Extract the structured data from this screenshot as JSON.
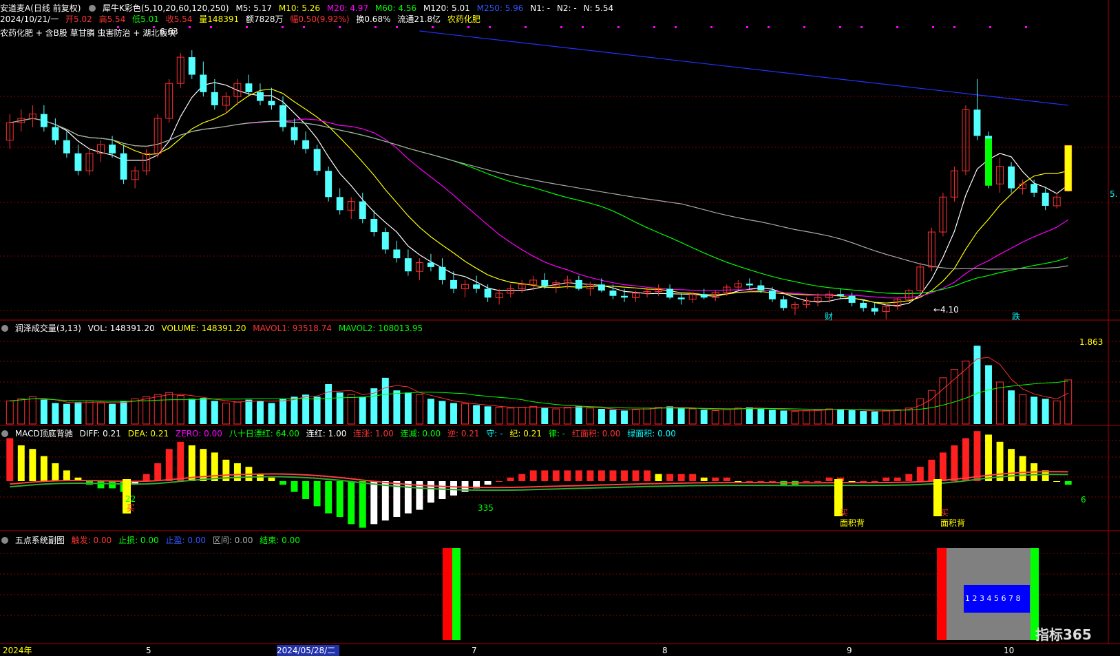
{
  "header": {
    "stock_title": "安道麦A(日线 前复权)",
    "indicator_name": "犀牛K彩色(5,10,20,60,120,250)",
    "ma5": "M5: 5.17",
    "ma10": "M10: 5.26",
    "ma20": "M20: 4.97",
    "ma60": "M60: 4.56",
    "ma120": "M120: 5.01",
    "ma250": "M250: 5.96",
    "n1": "N1: -",
    "n2": "N2: -",
    "n": "N: 5.54",
    "date_line": "2024/10/21/一",
    "open": "开5.02",
    "high": "高5.54",
    "low": "低5.01",
    "close": "收5.54",
    "volume": "量148391",
    "amount": "额7828万",
    "change": "幅0.50(9.92%)",
    "turnover": "换0.68%",
    "float_cap": "流通21.8亿",
    "sector": "农药化肥",
    "concepts": "农药化肥 + 含B股 草甘膦 虫害防治 + 湖北板块",
    "peak_label": "6.63",
    "low_label": "←4.10",
    "mark_cai": "财",
    "mark_die": "跌"
  },
  "volume_panel": {
    "title": "润泽成交量(3,13)",
    "vol": "VOL: 148391.20",
    "volume": "VOLUME: 148391.20",
    "mavol1": "MAVOL1: 93518.74",
    "mavol2": "MAVOL2: 108013.95",
    "max_label": "1.863"
  },
  "macd_panel": {
    "title": "MACD顶底背驰",
    "diff": "DIFF: 0.21",
    "dea": "DEA: 0.21",
    "zero": "ZERO: 0.00",
    "eighty": "八十日漂红: 64.00",
    "lianhong": "连红: 1.00",
    "lianzhang": "连涨: 1.00",
    "lianjian": "连减: 0.00",
    "ni": "逆: 0.21",
    "shou": "守: -",
    "ji": "纪: 0.21",
    "lv": "律: -",
    "red_area": "红面积: 0.00",
    "green_area": "绿面积: 0.00",
    "label_22": "22",
    "label_335": "335",
    "label_6": "6",
    "buy": "买",
    "area_div": "面积背"
  },
  "five_panel": {
    "title": "五点系统副图",
    "chufa": "触发: 0.00",
    "zhisun": "止损: 0.00",
    "zhiying": "止盈: 0.00",
    "qujian": "区间: 0.00",
    "jieshu": "结束: 0.00",
    "box_label": "1 2 3 4 5 6 7 8"
  },
  "time_axis": {
    "labels": [
      "2024年",
      "5",
      "2024/05/28/二",
      "7",
      "8",
      "9",
      "10"
    ]
  },
  "watermark": "指标365",
  "price_axis_label": "5.",
  "colors": {
    "up": "#ff3030",
    "down": "#54ffff",
    "ma5": "#ffffff",
    "ma10": "#ffff00",
    "ma20": "#ff00ff",
    "ma60": "#00ff00",
    "ma120": "#aaaaaa",
    "ma250": "#2233ff",
    "grid": "#8b0000"
  },
  "chart_data": {
    "type": "candlestick",
    "price_range": [
      3.7,
      6.85
    ],
    "candles": [
      [
        5.6,
        5.9,
        5.5,
        5.8
      ],
      [
        5.8,
        5.95,
        5.7,
        5.85
      ],
      [
        5.85,
        6.0,
        5.75,
        5.9
      ],
      [
        5.9,
        6.0,
        5.7,
        5.75
      ],
      [
        5.75,
        5.85,
        5.55,
        5.6
      ],
      [
        5.6,
        5.7,
        5.4,
        5.45
      ],
      [
        5.45,
        5.55,
        5.2,
        5.25
      ],
      [
        5.25,
        5.5,
        5.2,
        5.45
      ],
      [
        5.45,
        5.6,
        5.35,
        5.55
      ],
      [
        5.55,
        5.65,
        5.4,
        5.45
      ],
      [
        5.45,
        5.55,
        5.1,
        5.15
      ],
      [
        5.15,
        5.3,
        5.05,
        5.25
      ],
      [
        5.25,
        5.5,
        5.2,
        5.45
      ],
      [
        5.45,
        5.9,
        5.4,
        5.85
      ],
      [
        5.85,
        6.3,
        5.8,
        6.25
      ],
      [
        6.25,
        6.6,
        6.2,
        6.55
      ],
      [
        6.55,
        6.63,
        6.3,
        6.35
      ],
      [
        6.35,
        6.5,
        6.1,
        6.15
      ],
      [
        6.15,
        6.3,
        5.95,
        6.0
      ],
      [
        6.0,
        6.15,
        5.9,
        6.1
      ],
      [
        6.1,
        6.3,
        6.0,
        6.25
      ],
      [
        6.25,
        6.35,
        6.1,
        6.15
      ],
      [
        6.15,
        6.25,
        6.0,
        6.05
      ],
      [
        6.05,
        6.2,
        5.95,
        6.0
      ],
      [
        6.0,
        6.1,
        5.7,
        5.75
      ],
      [
        5.75,
        5.85,
        5.55,
        5.6
      ],
      [
        5.6,
        5.7,
        5.45,
        5.5
      ],
      [
        5.5,
        5.55,
        5.2,
        5.25
      ],
      [
        5.25,
        5.3,
        4.9,
        4.95
      ],
      [
        4.95,
        5.05,
        4.75,
        4.8
      ],
      [
        4.8,
        4.95,
        4.7,
        4.9
      ],
      [
        4.9,
        5.0,
        4.65,
        4.7
      ],
      [
        4.7,
        4.8,
        4.5,
        4.55
      ],
      [
        4.55,
        4.6,
        4.3,
        4.35
      ],
      [
        4.35,
        4.45,
        4.2,
        4.25
      ],
      [
        4.25,
        4.35,
        4.05,
        4.1
      ],
      [
        4.1,
        4.25,
        4.0,
        4.2
      ],
      [
        4.2,
        4.3,
        4.1,
        4.15
      ],
      [
        4.15,
        4.25,
        3.95,
        4.0
      ],
      [
        4.0,
        4.1,
        3.85,
        3.9
      ],
      [
        3.9,
        4.0,
        3.8,
        3.95
      ],
      [
        3.95,
        4.05,
        3.85,
        3.9
      ],
      [
        3.9,
        3.95,
        3.75,
        3.8
      ],
      [
        3.8,
        3.9,
        3.72,
        3.85
      ],
      [
        3.85,
        3.95,
        3.8,
        3.9
      ],
      [
        3.9,
        4.0,
        3.85,
        3.95
      ],
      [
        3.95,
        4.05,
        3.88,
        4.0
      ],
      [
        4.0,
        4.08,
        3.9,
        3.93
      ],
      [
        3.93,
        4.0,
        3.85,
        3.97
      ],
      [
        3.97,
        4.05,
        3.9,
        4.0
      ],
      [
        4.0,
        4.05,
        3.88,
        3.9
      ],
      [
        3.9,
        3.98,
        3.82,
        3.95
      ],
      [
        3.95,
        4.02,
        3.86,
        3.88
      ],
      [
        3.88,
        3.95,
        3.78,
        3.82
      ],
      [
        3.82,
        3.9,
        3.75,
        3.8
      ],
      [
        3.8,
        3.88,
        3.75,
        3.85
      ],
      [
        3.85,
        3.92,
        3.8,
        3.87
      ],
      [
        3.87,
        3.95,
        3.82,
        3.9
      ],
      [
        3.9,
        3.95,
        3.78,
        3.8
      ],
      [
        3.8,
        3.85,
        3.72,
        3.78
      ],
      [
        3.78,
        3.86,
        3.74,
        3.84
      ],
      [
        3.84,
        3.9,
        3.78,
        3.8
      ],
      [
        3.8,
        3.88,
        3.76,
        3.86
      ],
      [
        3.86,
        3.95,
        3.82,
        3.92
      ],
      [
        3.92,
        4.0,
        3.88,
        3.96
      ],
      [
        3.96,
        4.02,
        3.9,
        3.94
      ],
      [
        3.94,
        4.0,
        3.85,
        3.88
      ],
      [
        3.88,
        3.92,
        3.75,
        3.78
      ],
      [
        3.78,
        3.82,
        3.65,
        3.68
      ],
      [
        3.68,
        3.75,
        3.6,
        3.72
      ],
      [
        3.72,
        3.8,
        3.68,
        3.76
      ],
      [
        3.76,
        3.85,
        3.7,
        3.8
      ],
      [
        3.8,
        3.88,
        3.74,
        3.84
      ],
      [
        3.84,
        3.9,
        3.78,
        3.82
      ],
      [
        3.82,
        3.86,
        3.7,
        3.74
      ],
      [
        3.74,
        3.78,
        3.64,
        3.68
      ],
      [
        3.68,
        3.74,
        3.6,
        3.64
      ],
      [
        3.64,
        3.72,
        3.55,
        3.7
      ],
      [
        3.7,
        3.8,
        3.66,
        3.78
      ],
      [
        3.78,
        3.9,
        3.75,
        3.88
      ],
      [
        3.88,
        4.2,
        3.85,
        4.15
      ],
      [
        4.15,
        4.6,
        4.1,
        4.55
      ],
      [
        4.55,
        5.0,
        4.5,
        4.95
      ],
      [
        4.95,
        5.3,
        4.9,
        5.25
      ],
      [
        5.25,
        6.0,
        5.2,
        5.95
      ],
      [
        5.95,
        6.3,
        5.6,
        5.65
      ],
      [
        5.65,
        5.7,
        5.05,
        5.1
      ],
      [
        5.1,
        5.4,
        5.0,
        5.3
      ],
      [
        5.3,
        5.35,
        5.0,
        5.05
      ],
      [
        5.05,
        5.15,
        4.98,
        5.1
      ],
      [
        5.1,
        5.15,
        4.95,
        5.0
      ],
      [
        5.0,
        5.05,
        4.8,
        4.85
      ],
      [
        4.85,
        5.0,
        4.82,
        4.95
      ],
      [
        5.02,
        5.54,
        5.01,
        5.54
      ]
    ],
    "volume_values": [
      0.55,
      0.6,
      0.65,
      0.58,
      0.5,
      0.48,
      0.52,
      0.55,
      0.5,
      0.48,
      0.55,
      0.6,
      0.65,
      0.7,
      0.75,
      0.68,
      0.6,
      0.62,
      0.55,
      0.5,
      0.52,
      0.58,
      0.55,
      0.5,
      0.6,
      0.65,
      0.7,
      0.65,
      0.95,
      0.75,
      0.7,
      0.65,
      0.85,
      1.1,
      0.8,
      0.75,
      0.7,
      0.6,
      0.55,
      0.5,
      0.48,
      0.45,
      0.42,
      0.4,
      0.38,
      0.4,
      0.42,
      0.38,
      0.36,
      0.4,
      0.42,
      0.38,
      0.36,
      0.34,
      0.32,
      0.35,
      0.38,
      0.4,
      0.42,
      0.38,
      0.36,
      0.34,
      0.32,
      0.36,
      0.38,
      0.4,
      0.36,
      0.34,
      0.32,
      0.3,
      0.32,
      0.34,
      0.36,
      0.35,
      0.33,
      0.31,
      0.3,
      0.32,
      0.34,
      0.38,
      0.6,
      0.8,
      1.1,
      1.3,
      1.5,
      1.863,
      1.4,
      1.0,
      0.8,
      0.7,
      0.65,
      0.6,
      0.55,
      1.05
    ],
    "macd_hist": [
      0.12,
      0.1,
      0.09,
      0.07,
      0.05,
      0.03,
      0.01,
      -0.01,
      -0.02,
      -0.02,
      -0.03,
      -0.01,
      0.02,
      0.05,
      0.09,
      0.11,
      0.1,
      0.09,
      0.08,
      0.06,
      0.05,
      0.04,
      0.02,
      0.01,
      -0.01,
      -0.03,
      -0.05,
      -0.07,
      -0.09,
      -0.1,
      -0.12,
      -0.13,
      -0.12,
      -0.11,
      -0.1,
      -0.09,
      -0.08,
      -0.06,
      -0.05,
      -0.04,
      -0.03,
      -0.02,
      -0.01,
      0.0,
      0.01,
      0.02,
      0.03,
      0.03,
      0.03,
      0.03,
      0.03,
      0.03,
      0.03,
      0.03,
      0.03,
      0.03,
      0.03,
      0.02,
      0.02,
      0.02,
      0.02,
      0.01,
      0.01,
      0.01,
      0.0,
      0.0,
      0.0,
      0.0,
      -0.01,
      -0.01,
      0.0,
      0.0,
      0.01,
      0.01,
      0.0,
      0.0,
      0.0,
      0.01,
      0.01,
      0.02,
      0.04,
      0.06,
      0.08,
      0.1,
      0.12,
      0.14,
      0.13,
      0.11,
      0.09,
      0.07,
      0.05,
      0.03,
      0.0,
      -0.01
    ],
    "markers": {
      "peak_index": 16,
      "low_index": 77,
      "cai_index": 69,
      "die_index": 85
    }
  }
}
